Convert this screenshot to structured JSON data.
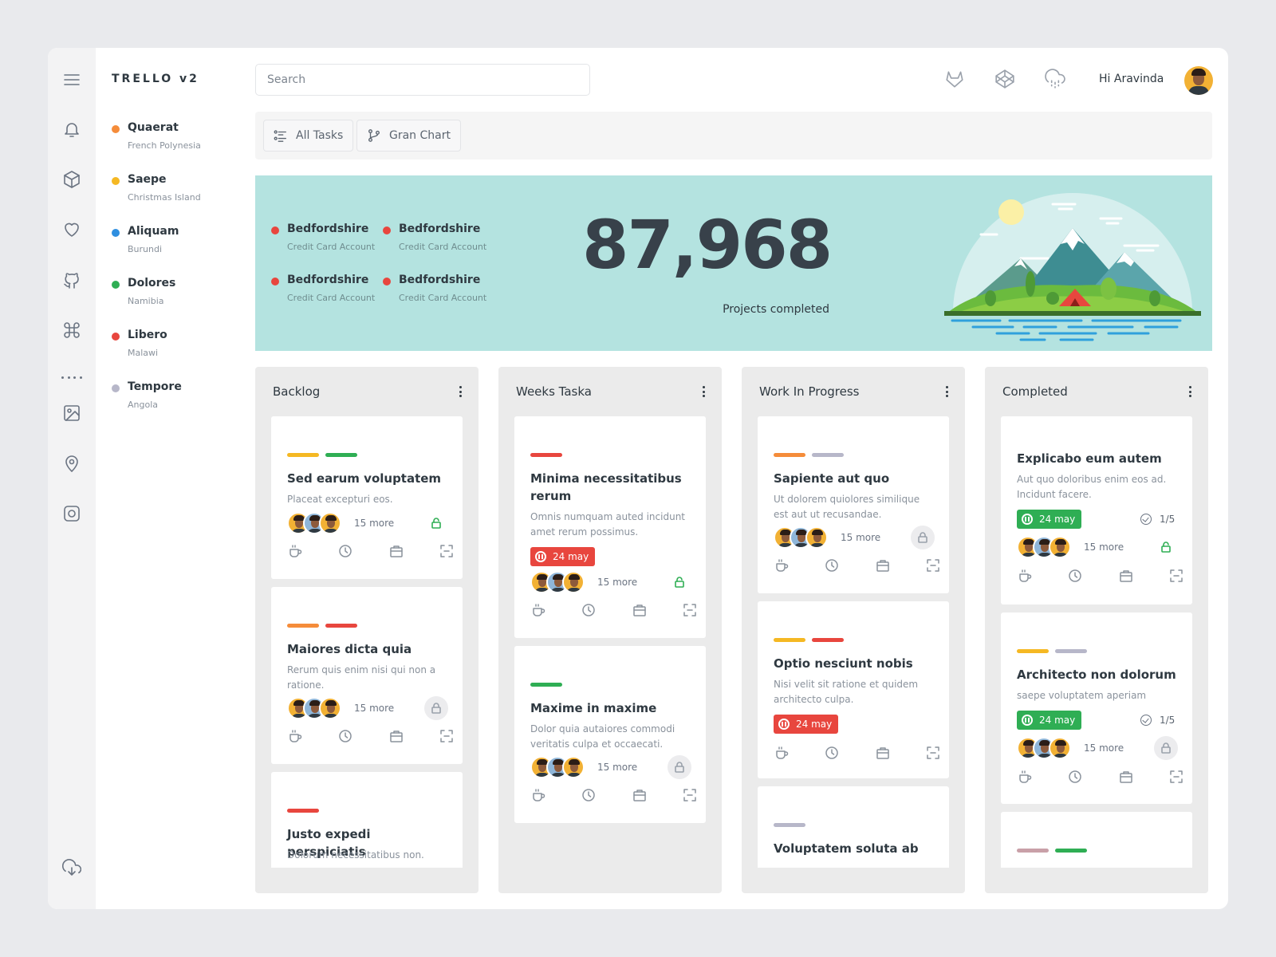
{
  "app": {
    "title": "TRELLO v2",
    "greeting": "Hi Aravinda"
  },
  "rail": {
    "icons": [
      "menu-icon",
      "bell-icon",
      "box-icon",
      "heart-icon",
      "github-icon",
      "command-icon",
      "more-icon",
      "image-icon",
      "location-pin-icon",
      "instagram-icon",
      "cloud-download-icon"
    ]
  },
  "projects": [
    {
      "name": "Quaerat",
      "sub": "French Polynesia",
      "color": "#f58c3a"
    },
    {
      "name": "Saepe",
      "sub": "Christmas Island",
      "color": "#f5b823"
    },
    {
      "name": "Aliquam",
      "sub": "Burundi",
      "color": "#2f8fe0"
    },
    {
      "name": "Dolores",
      "sub": "Namibia",
      "color": "#2fae54"
    },
    {
      "name": "Libero",
      "sub": "Malawi",
      "color": "#e8463e"
    },
    {
      "name": "Tempore",
      "sub": "Angola",
      "color": "#b7b7c9"
    }
  ],
  "search": {
    "placeholder": "Search"
  },
  "topbar": {
    "icons": [
      "gitlab-icon",
      "codepen-icon",
      "cloud-rain-icon"
    ]
  },
  "tabs": [
    {
      "label": "All Tasks",
      "icon": "list-icon"
    },
    {
      "label": "Gran Chart",
      "icon": "git-branch-icon"
    }
  ],
  "hero": {
    "accounts": [
      {
        "name": "Bedfordshire",
        "sub": "Credit Card Account"
      },
      {
        "name": "Bedfordshire",
        "sub": "Credit Card Account"
      },
      {
        "name": "Bedfordshire",
        "sub": "Credit Card Account"
      },
      {
        "name": "Bedfordshire",
        "sub": "Credit Card Account"
      }
    ],
    "number": "87,968",
    "label": "Projects completed"
  },
  "board": {
    "more_label": "15 more",
    "columns": [
      {
        "title": "Backlog",
        "cards": [
          {
            "tags": [
              "#f5b823",
              "#2fae54"
            ],
            "title": "Sed earum voluptatem",
            "desc": "Placeat excepturi eos.",
            "lock": "open"
          },
          {
            "tags": [
              "#f58c3a",
              "#e8463e"
            ],
            "title": "Maiores dicta quia",
            "desc": "Rerum quis enim nisi qui non a ratione.",
            "lock": "grey"
          },
          {
            "tags": [
              "#e8463e"
            ],
            "title": "Justo expedi perspiciatis",
            "desc": "Dolorum necessitatibus non."
          }
        ]
      },
      {
        "title": "Weeks Taska",
        "cards": [
          {
            "tags": [
              "#e8463e"
            ],
            "title": "Minima necessitatibus rerum",
            "desc": "Omnis numquam auted incidunt amet rerum possimus.",
            "badge": "24 may",
            "badge_color": "red",
            "lock": "open"
          },
          {
            "tags": [
              "#2fae54"
            ],
            "title": "Maxime in maxime",
            "desc": "Dolor quia autaiores commodi veritatis culpa et occaecati.",
            "lock": "grey"
          }
        ]
      },
      {
        "title": "Work In Progress",
        "cards": [
          {
            "tags": [
              "#f58c3a",
              "#b7b7c9"
            ],
            "title": "Sapiente aut quo",
            "desc": "Ut dolorem quiolores similique est aut ut recusandae.",
            "lock": "grey"
          },
          {
            "tags": [
              "#f5b823",
              "#e8463e"
            ],
            "title": "Optio nesciunt nobis",
            "desc": "Nisi velit sit ratione et quidem architecto culpa.",
            "badge": "24 may",
            "badge_color": "red"
          },
          {
            "tags": [
              "#b7b7c9"
            ],
            "title": "Voluptatem soluta ab"
          }
        ]
      },
      {
        "title": "Completed",
        "cards": [
          {
            "title": "Explicabo eum autem",
            "desc": "Aut quo doloribus enim eos ad. Incidunt facere.",
            "badge": "24 may",
            "badge_color": "green",
            "check": "1/5",
            "lock": "open"
          },
          {
            "tags": [
              "#f5b823",
              "#b7b7c9"
            ],
            "title": "Architecto non dolorum",
            "desc": "saepe voluptatem aperiam",
            "badge": "24 may",
            "badge_color": "green",
            "check": "1/5",
            "lock": "grey"
          },
          {
            "tags": [
              "#c9a0a8",
              "#2fae54"
            ]
          }
        ]
      }
    ]
  }
}
